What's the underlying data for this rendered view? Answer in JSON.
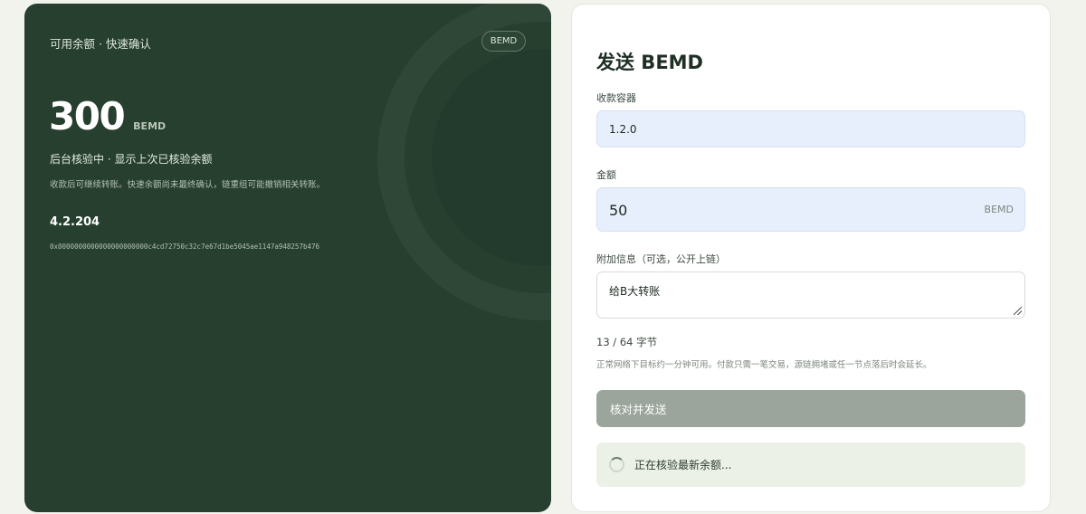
{
  "balance_card": {
    "subtitle": "可用余额 · 快速确认",
    "token_badge": "BEMD",
    "amount": "300",
    "amount_unit": "BEMD",
    "status": "后台核验中 · 显示上次已核验余额",
    "note": "收款后可继续转账。快速余额尚未最终确认，链重组可能撤销相关转账。",
    "version": "4.2.204",
    "address": "0x0000000000000000000000c4cd72750c32c7e67d1be5045ae1147a948257b476"
  },
  "send_form": {
    "title": "发送 BEMD",
    "recipient": {
      "label": "收款容器",
      "value": "1.2.0"
    },
    "amount": {
      "label": "金额",
      "value": "50",
      "unit": "BEMD"
    },
    "memo": {
      "label": "附加信息（可选，公开上链）",
      "value": "给B大转账"
    },
    "byte_count": "13 / 64 字节",
    "hint": "正常网络下目标约一分钟可用。付款只需一笔交易，源链拥堵或任一节点落后时会延长。",
    "submit_label": "核对并发送",
    "status_text": "正在核验最新余额..."
  },
  "colors": {
    "card_bg": "#263f2f",
    "input_bg": "#e8effc",
    "button_bg": "#9ba59c",
    "status_bg": "#ebf1e6"
  }
}
